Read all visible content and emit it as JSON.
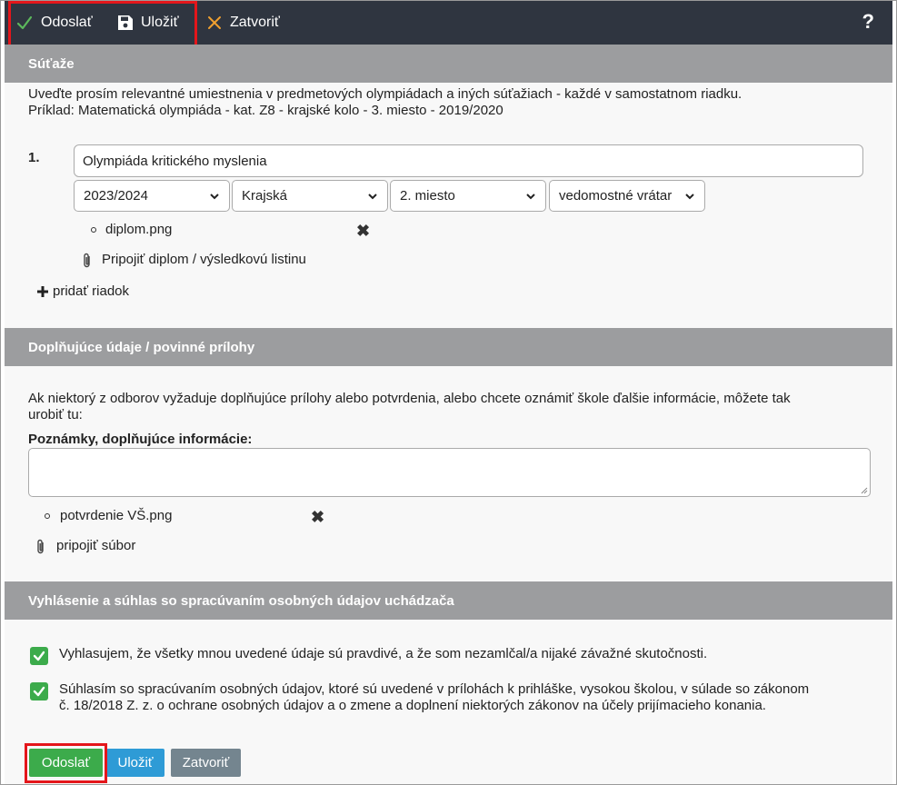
{
  "toolbar": {
    "send_label": "Odoslať",
    "save_label": "Uložiť",
    "close_label": "Zatvoriť",
    "help_label": "?"
  },
  "colors": {
    "toolbar_bg": "#2f3540",
    "section_header_bg": "#9c9d9f",
    "highlight": "#e4161b",
    "send_green": "#3cab4b",
    "save_blue": "#2e9bd6",
    "close_gray": "#74858f"
  },
  "competitions": {
    "title": "Súťaže",
    "intro_line1": "Uveďte prosím relevantné umiestnenia v predmetových olympiádach a iných súťažiach - každé v samostatnom riadku.",
    "intro_line2": "Príklad: Matematická olympiáda - kat. Z8 - krajské kolo - 3. miesto - 2019/2020",
    "rows": [
      {
        "number": "1.",
        "name": "Olympiáda kritického myslenia",
        "year": "2023/2024",
        "level": "Krajská",
        "place": "2. miesto",
        "category": "vedomostné vrátar",
        "attachment": "diplom.png"
      }
    ],
    "attach_label": "Pripojiť diplom / výsledkovú listinu",
    "add_row_label": "pridať riadok"
  },
  "supplementary": {
    "title": "Doplňujúce údaje / povinné prílohy",
    "intro_line1": "Ak niektorý z odborov vyžaduje doplňujúce prílohy alebo potvrdenia, alebo chcete oznámiť škole ďalšie informácie, môžete tak",
    "intro_line2": "urobiť tu:",
    "notes_label": "Poznámky, doplňujúce informácie:",
    "notes_value": "",
    "attachment": "potvrdenie VŠ.png",
    "attach_label": "pripojiť súbor"
  },
  "declaration": {
    "title": "Vyhlásenie a súhlas so spracúvaním osobných údajov uchádzača",
    "item1": "Vyhlasujem, že všetky mnou uvedené údaje sú pravdivé, a že som nezamlčal/a nijaké závažné skutočnosti.",
    "item2_line1": "Súhlasím so spracúvaním osobných údajov, ktoré sú uvedené v prílohách k prihláške, vysokou školou, v súlade so zákonom",
    "item2_line2": "č. 18/2018 Z. z. o ochrane osobných údajov a o zmene a doplnení niektorých zákonov na účely prijímacieho konania."
  },
  "footer": {
    "send_label": "Odoslať",
    "save_label": "Uložiť",
    "close_label": "Zatvoriť"
  }
}
